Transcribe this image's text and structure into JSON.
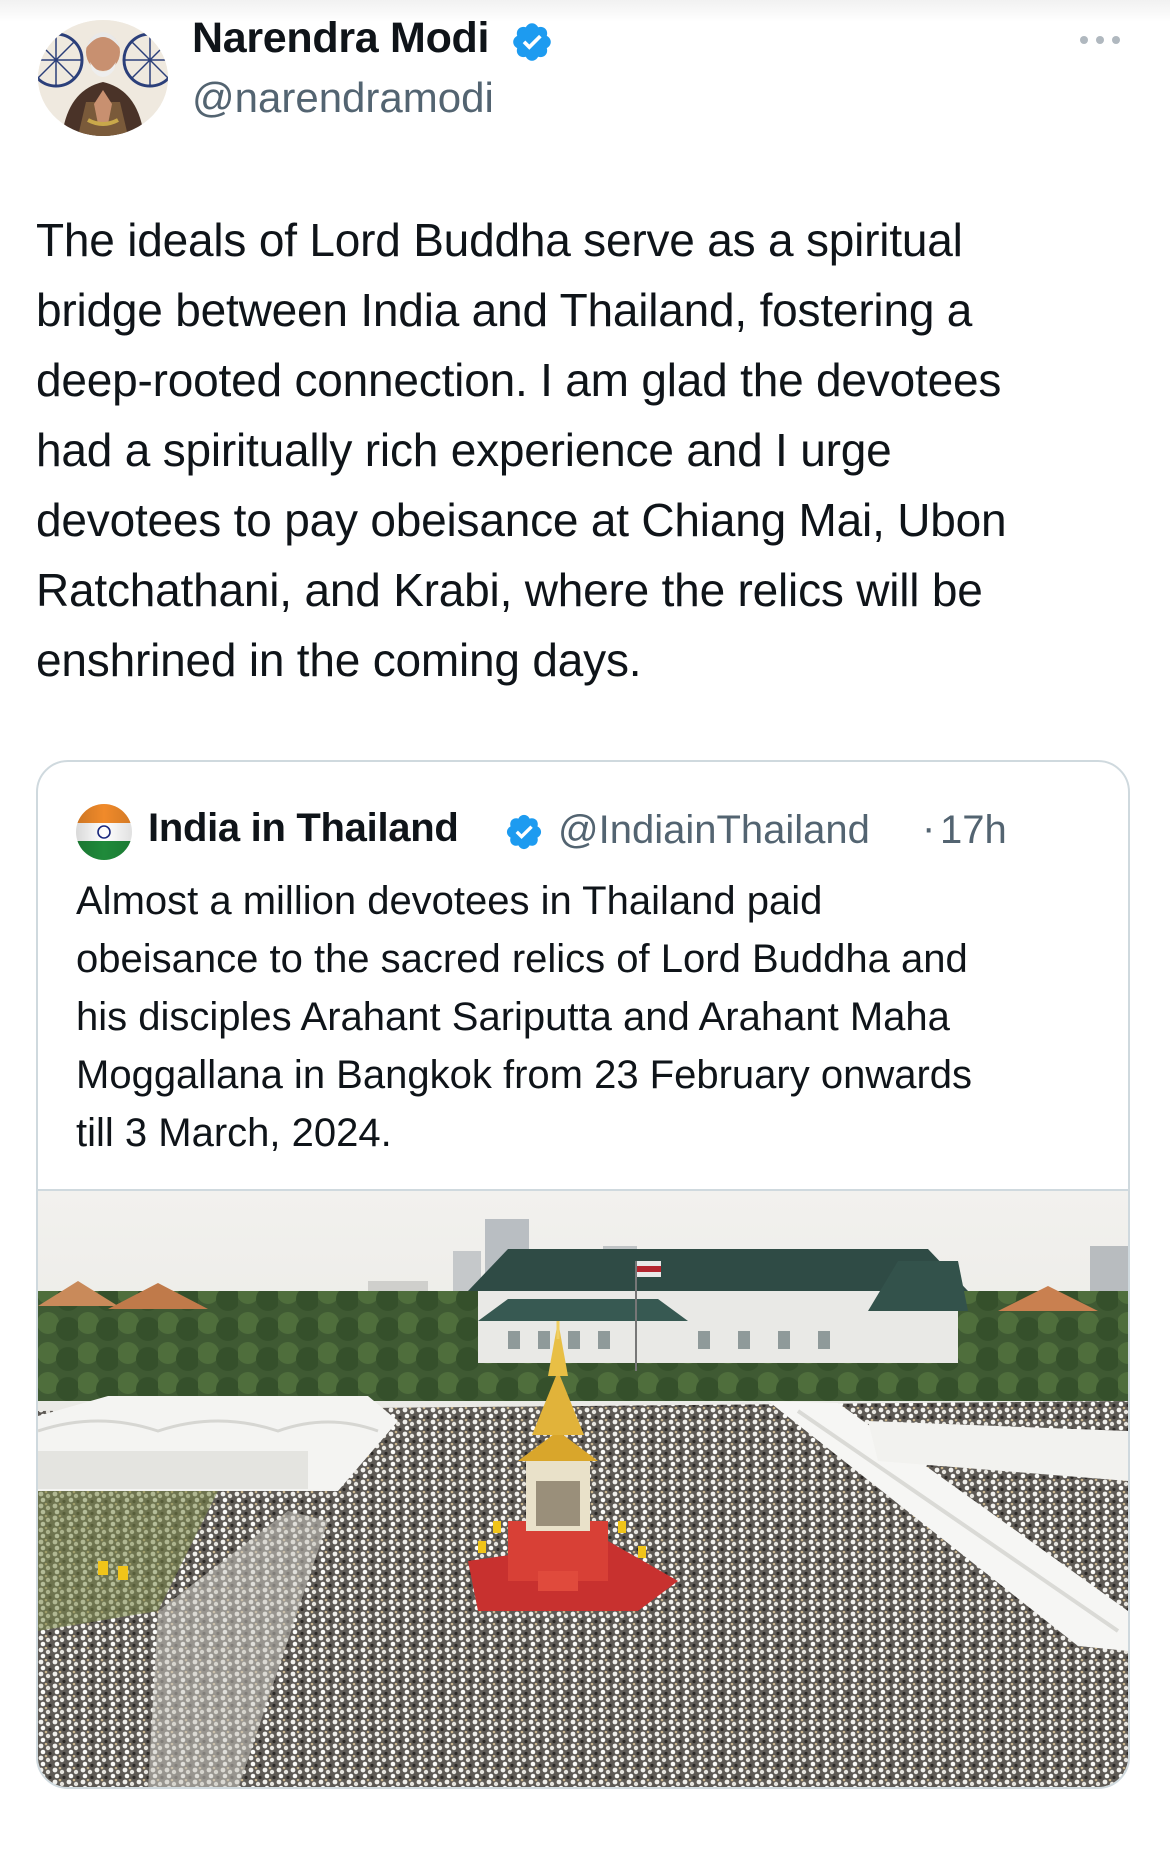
{
  "tweet": {
    "author": {
      "name": "Narendra Modi",
      "handle": "@narendramodi",
      "avatar_icon": "profile-photo",
      "verified_icon": "verified-badge-icon"
    },
    "more_icon": "more-horizontal-icon",
    "text": "The ideals of Lord Buddha serve as a spiritual\nbridge between India and Thailand, fostering a\ndeep-rooted connection. I am glad the devotees\nhad a spiritually rich experience and I urge\ndevotees to pay obeisance at Chiang Mai, Ubon\nRatchathani, and Krabi, where the relics will be\nenshrined in the coming days."
  },
  "quoted_tweet": {
    "author": {
      "name": "India in Thailand",
      "handle": "@IndiainThailand",
      "verified_icon": "verified-badge-icon",
      "avatar_icon": "india-flag-icon"
    },
    "separator": "·",
    "time": "17h",
    "text": "Almost a million devotees in Thailand paid\nobeisance to the sacred relics of Lord Buddha and\nhis disciples Arahant Sariputta and Arahant Maha\nMoggallana in Bangkok from 23 February onwards\ntill 3 March, 2024.",
    "image": {
      "alt": "Aerial view of a large crowd of devotees around a golden pavilion in Bangkok"
    }
  },
  "colors": {
    "text": "#0f1419",
    "secondary_text": "#536471",
    "verified_blue": "#1d9bf0",
    "border": "#cfd9de"
  }
}
